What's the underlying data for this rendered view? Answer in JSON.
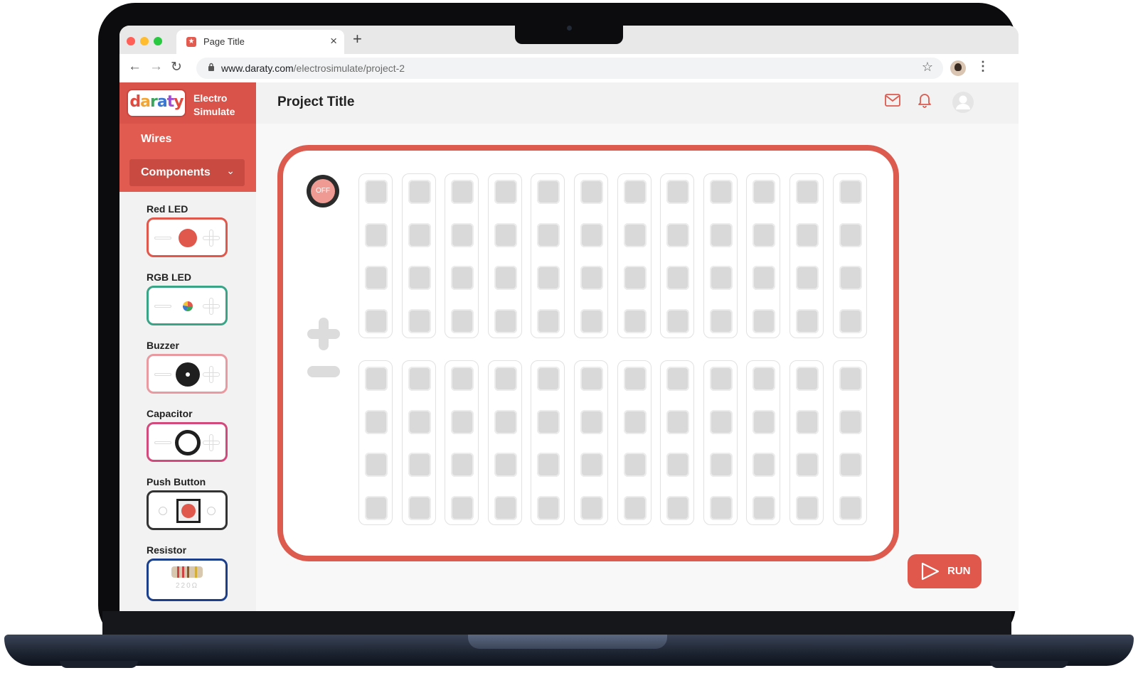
{
  "browser": {
    "tab_title": "Page Title",
    "tab_close": "×",
    "new_tab": "+",
    "url_host": "www.daraty.com",
    "url_path": "/electrosimulate/project-2"
  },
  "sidebar": {
    "logo_text": "daraty",
    "brand_line1": "Electro",
    "brand_line2": "Simulate",
    "wires_label": "Wires",
    "components_label": "Components",
    "components": [
      {
        "label": "Red LED",
        "color": "#e0574c"
      },
      {
        "label": "RGB LED",
        "color": "#3aa487"
      },
      {
        "label": "Buzzer",
        "color": "#e89aa0"
      },
      {
        "label": "Capacitor",
        "color": "#d14a7b"
      },
      {
        "label": "Push Button",
        "color": "#333333"
      },
      {
        "label": "Resistor",
        "color": "#1c3f8c"
      }
    ],
    "resistor_value": "220Ω"
  },
  "header": {
    "project_title": "Project Title"
  },
  "board": {
    "power_label": "OFF",
    "columns": 12,
    "rows_per_bank": 4
  },
  "run_label": "RUN",
  "colors": {
    "accent": "#dd5a4f",
    "accent_dark": "#c94a40"
  }
}
